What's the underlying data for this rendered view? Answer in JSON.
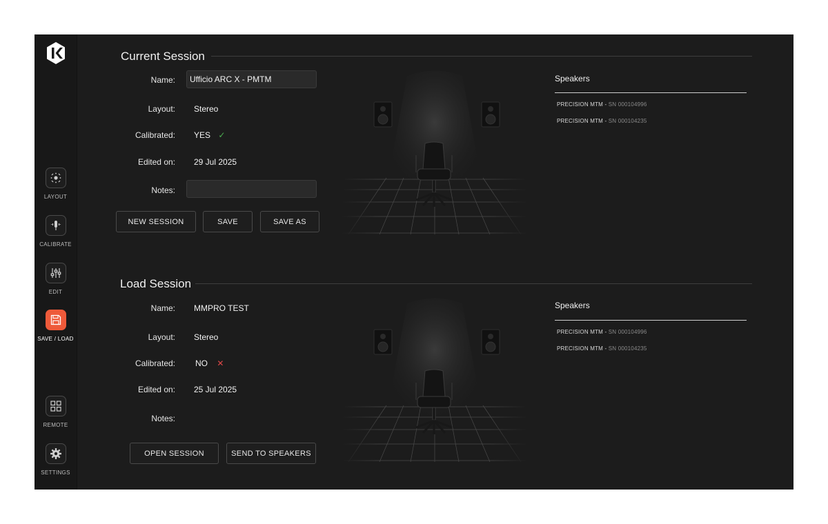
{
  "sidebar": {
    "logo": "ik-logo",
    "items": [
      {
        "label": "LAYOUT",
        "icon": "layout-icon",
        "active": false
      },
      {
        "label": "CALIBRATE",
        "icon": "microphone-icon",
        "active": false
      },
      {
        "label": "EDIT",
        "icon": "sliders-icon",
        "active": false
      },
      {
        "label": "SAVE / LOAD",
        "icon": "save-icon",
        "active": true
      },
      {
        "label": "REMOTE",
        "icon": "grid-icon",
        "active": false
      },
      {
        "label": "SETTINGS",
        "icon": "gear-icon",
        "active": false
      }
    ]
  },
  "colors": {
    "accent": "#ee5a3a",
    "check": "#4caf50",
    "cross": "#e04848",
    "background": "#1c1c1c"
  },
  "current": {
    "title": "Current Session",
    "name_label": "Name:",
    "name_value": "Ufficio ARC X - PMTM",
    "layout_label": "Layout:",
    "layout_value": "Stereo",
    "calibrated_label": "Calibrated:",
    "calibrated_value": "YES",
    "calibrated_mark": "✓",
    "edited_label": "Edited on:",
    "edited_value": "29 Jul 2025",
    "notes_label": "Notes:",
    "notes_value": "",
    "buttons": {
      "new_session": "NEW SESSION",
      "save": "SAVE",
      "save_as": "SAVE AS"
    },
    "speakers_title": "Speakers",
    "speakers": [
      {
        "model": "PRECISION MTM",
        "sep": " - ",
        "sn": "SN 000104996"
      },
      {
        "model": "PRECISION MTM",
        "sep": " - ",
        "sn": "SN 000104235"
      }
    ]
  },
  "load": {
    "title": "Load Session",
    "name_label": "Name:",
    "name_value": "MMPRO TEST",
    "layout_label": "Layout:",
    "layout_value": "Stereo",
    "calibrated_label": "Calibrated:",
    "calibrated_value": "NO",
    "calibrated_mark": "✕",
    "edited_label": "Edited on:",
    "edited_value": "25 Jul 2025",
    "notes_label": "Notes:",
    "notes_value": "",
    "buttons": {
      "open_session": "OPEN SESSION",
      "send_to_speakers": "SEND TO SPEAKERS"
    },
    "speakers_title": "Speakers",
    "speakers": [
      {
        "model": "PRECISION MTM",
        "sep": " - ",
        "sn": "SN 000104996"
      },
      {
        "model": "PRECISION MTM",
        "sep": " - ",
        "sn": "SN 000104235"
      }
    ]
  }
}
